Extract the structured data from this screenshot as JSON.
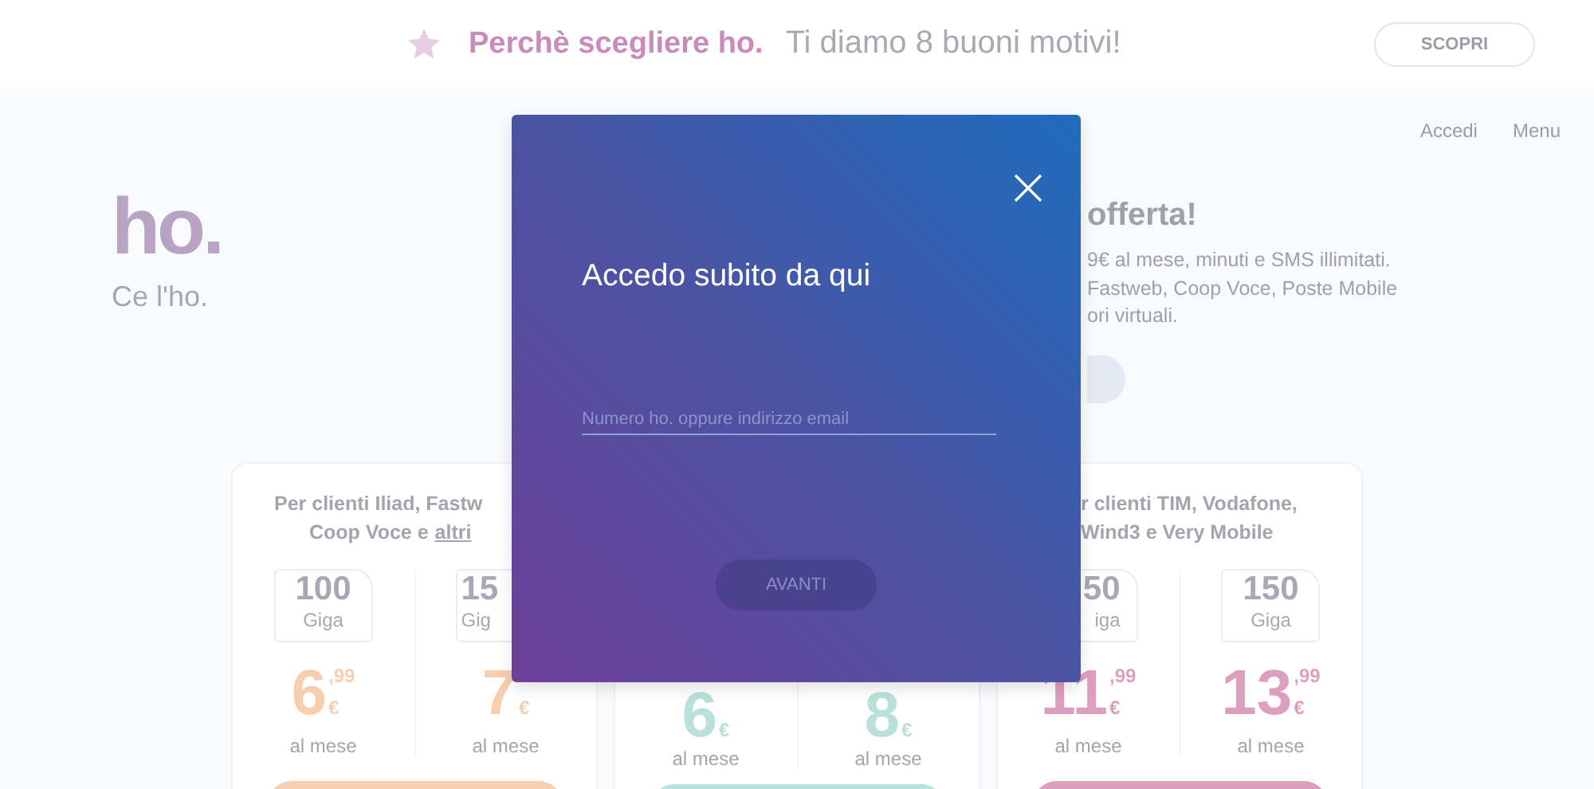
{
  "banner": {
    "title": "Perchè scegliere ho.",
    "subtitle": "Ti diamo 8 buoni motivi!",
    "button": "SCOPRI"
  },
  "nav": [
    "Accedi",
    "Menu"
  ],
  "logo": {
    "mark": "ho.",
    "tagline": "Ce l'ho."
  },
  "hero": {
    "heading": "offerta!",
    "lines": [
      "9€ al mese, minuti e SMS illimitati.",
      "Fastweb, Coop Voce, Poste Mobile",
      "ori virtuali."
    ]
  },
  "plans": [
    {
      "color": "#f7cfae",
      "header": [
        {
          "text": "Per clienti Iliad, Fastw"
        },
        {
          "text": "Coop Voce e",
          "link": "altri"
        }
      ],
      "items": [
        {
          "gb": "100",
          "unit": "Giga",
          "euros": "6",
          "cents": ",99",
          "currency": "€",
          "period": "al mese"
        },
        {
          "gb": "15",
          "unit": "Gig",
          "euros": "7",
          "currency": "€",
          "period": "al mese"
        }
      ]
    },
    {
      "color": "#b9e0da",
      "items": [
        {
          "euros": "6",
          "currency": "€",
          "period": "al mese"
        },
        {
          "euros": "8",
          "currency": "€",
          "period": "al mese"
        }
      ]
    },
    {
      "color": "#dd9fbe",
      "header": [
        {
          "text": "r clienti TIM, Vodafone,"
        },
        {
          "text": "Wind3 e Very Mobile"
        }
      ],
      "items": [
        {
          "gb": "50",
          "unit": "iga",
          "euros": "11",
          "cents": ",99",
          "currency": "€",
          "period": "al mese"
        },
        {
          "gb": "150",
          "unit": "Giga",
          "euros": "13",
          "cents": ",99",
          "currency": "€",
          "period": "al mese"
        }
      ]
    }
  ],
  "modal": {
    "title": "Accedo subito da qui",
    "field": {
      "placeholder": "Numero ho. oppure indirizzo email"
    },
    "button": {
      "label": "AVANTI",
      "disabled": true
    }
  }
}
